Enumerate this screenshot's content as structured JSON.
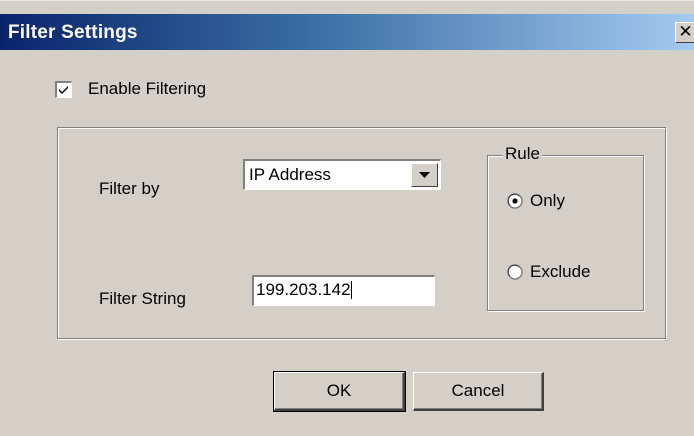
{
  "window": {
    "title": "Filter Settings",
    "close_glyph": "✕",
    "title_bar_color": "#0a246a",
    "face_color": "#d4d0c8"
  },
  "enable_filtering": {
    "label": "Enable Filtering",
    "checked": true
  },
  "filter_by": {
    "label": "Filter by",
    "selected": "IP Address"
  },
  "filter_string": {
    "label": "Filter String",
    "value": "199.203.142"
  },
  "rule": {
    "legend": "Rule",
    "options": [
      {
        "label": "Only",
        "selected": true
      },
      {
        "label": "Exclude",
        "selected": false
      }
    ]
  },
  "buttons": {
    "ok_label": "OK",
    "cancel_label": "Cancel"
  },
  "icons": {
    "checkbox": "check-icon",
    "dropdown": "chevron-down-icon",
    "close": "close-icon"
  }
}
